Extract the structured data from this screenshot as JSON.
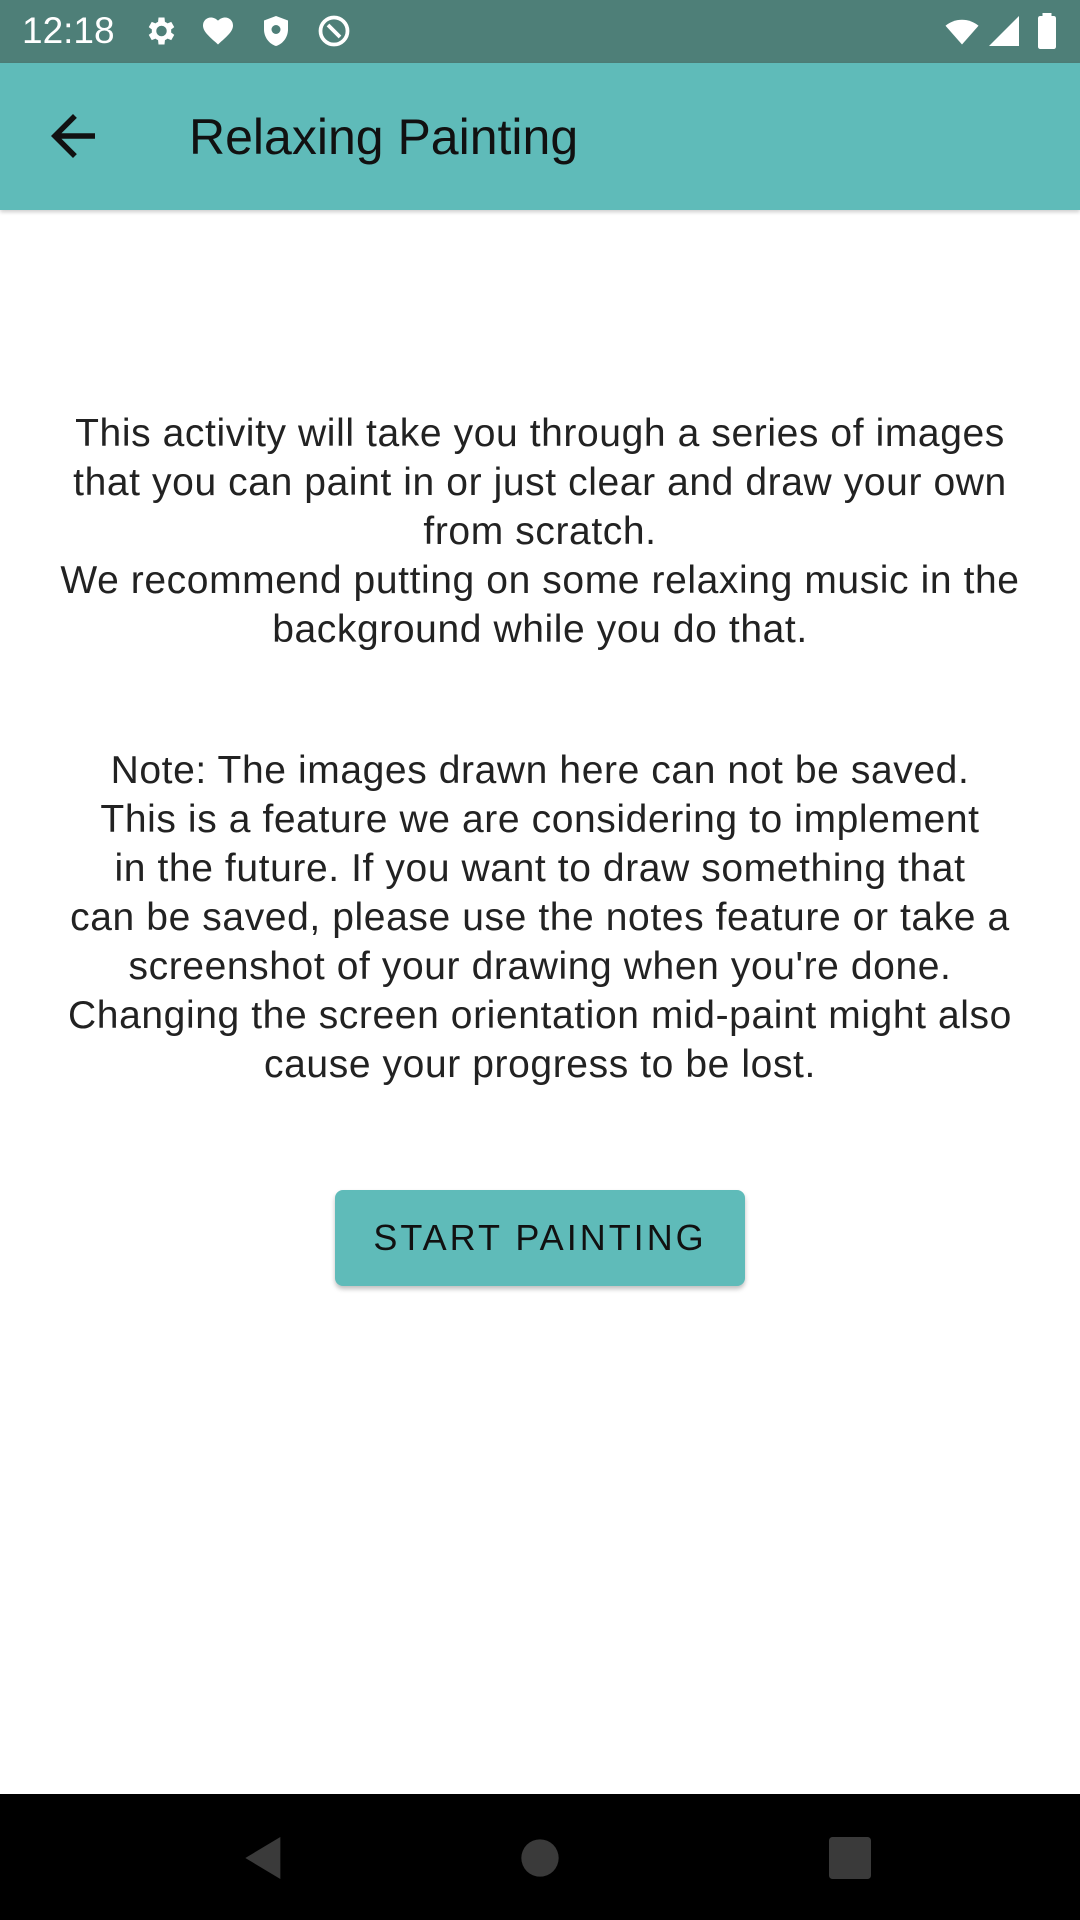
{
  "status_bar": {
    "time": "12:18",
    "icons_left": [
      "settings-icon",
      "heart-icon",
      "shield-icon",
      "at-icon"
    ],
    "icons_right": [
      "wifi-icon",
      "signal-icon",
      "battery-icon"
    ],
    "background": "#4e7f78"
  },
  "app_bar": {
    "title": "Relaxing Painting",
    "back_icon": "arrow-back-icon",
    "background": "#5fbbb9"
  },
  "intro": {
    "lines": [
      "This activity will take you through a series of images",
      "that you can paint in or just clear and draw your own",
      "from scratch.",
      "We recommend putting on some relaxing music in the",
      "background while you do that."
    ]
  },
  "note": {
    "lines": [
      "Note: The images drawn here can not be saved.",
      "This is a feature we are considering to implement",
      "in the future. If you want to draw something that",
      "can be saved, please use the notes feature or take a",
      "screenshot of your drawing when you're done.",
      "Changing the screen orientation mid-paint might also",
      "cause your progress to be lost."
    ]
  },
  "actions": {
    "start_label": "START PAINTING"
  },
  "nav_bar": {
    "buttons": [
      "back-triangle-icon",
      "home-circle-icon",
      "recents-square-icon"
    ]
  }
}
